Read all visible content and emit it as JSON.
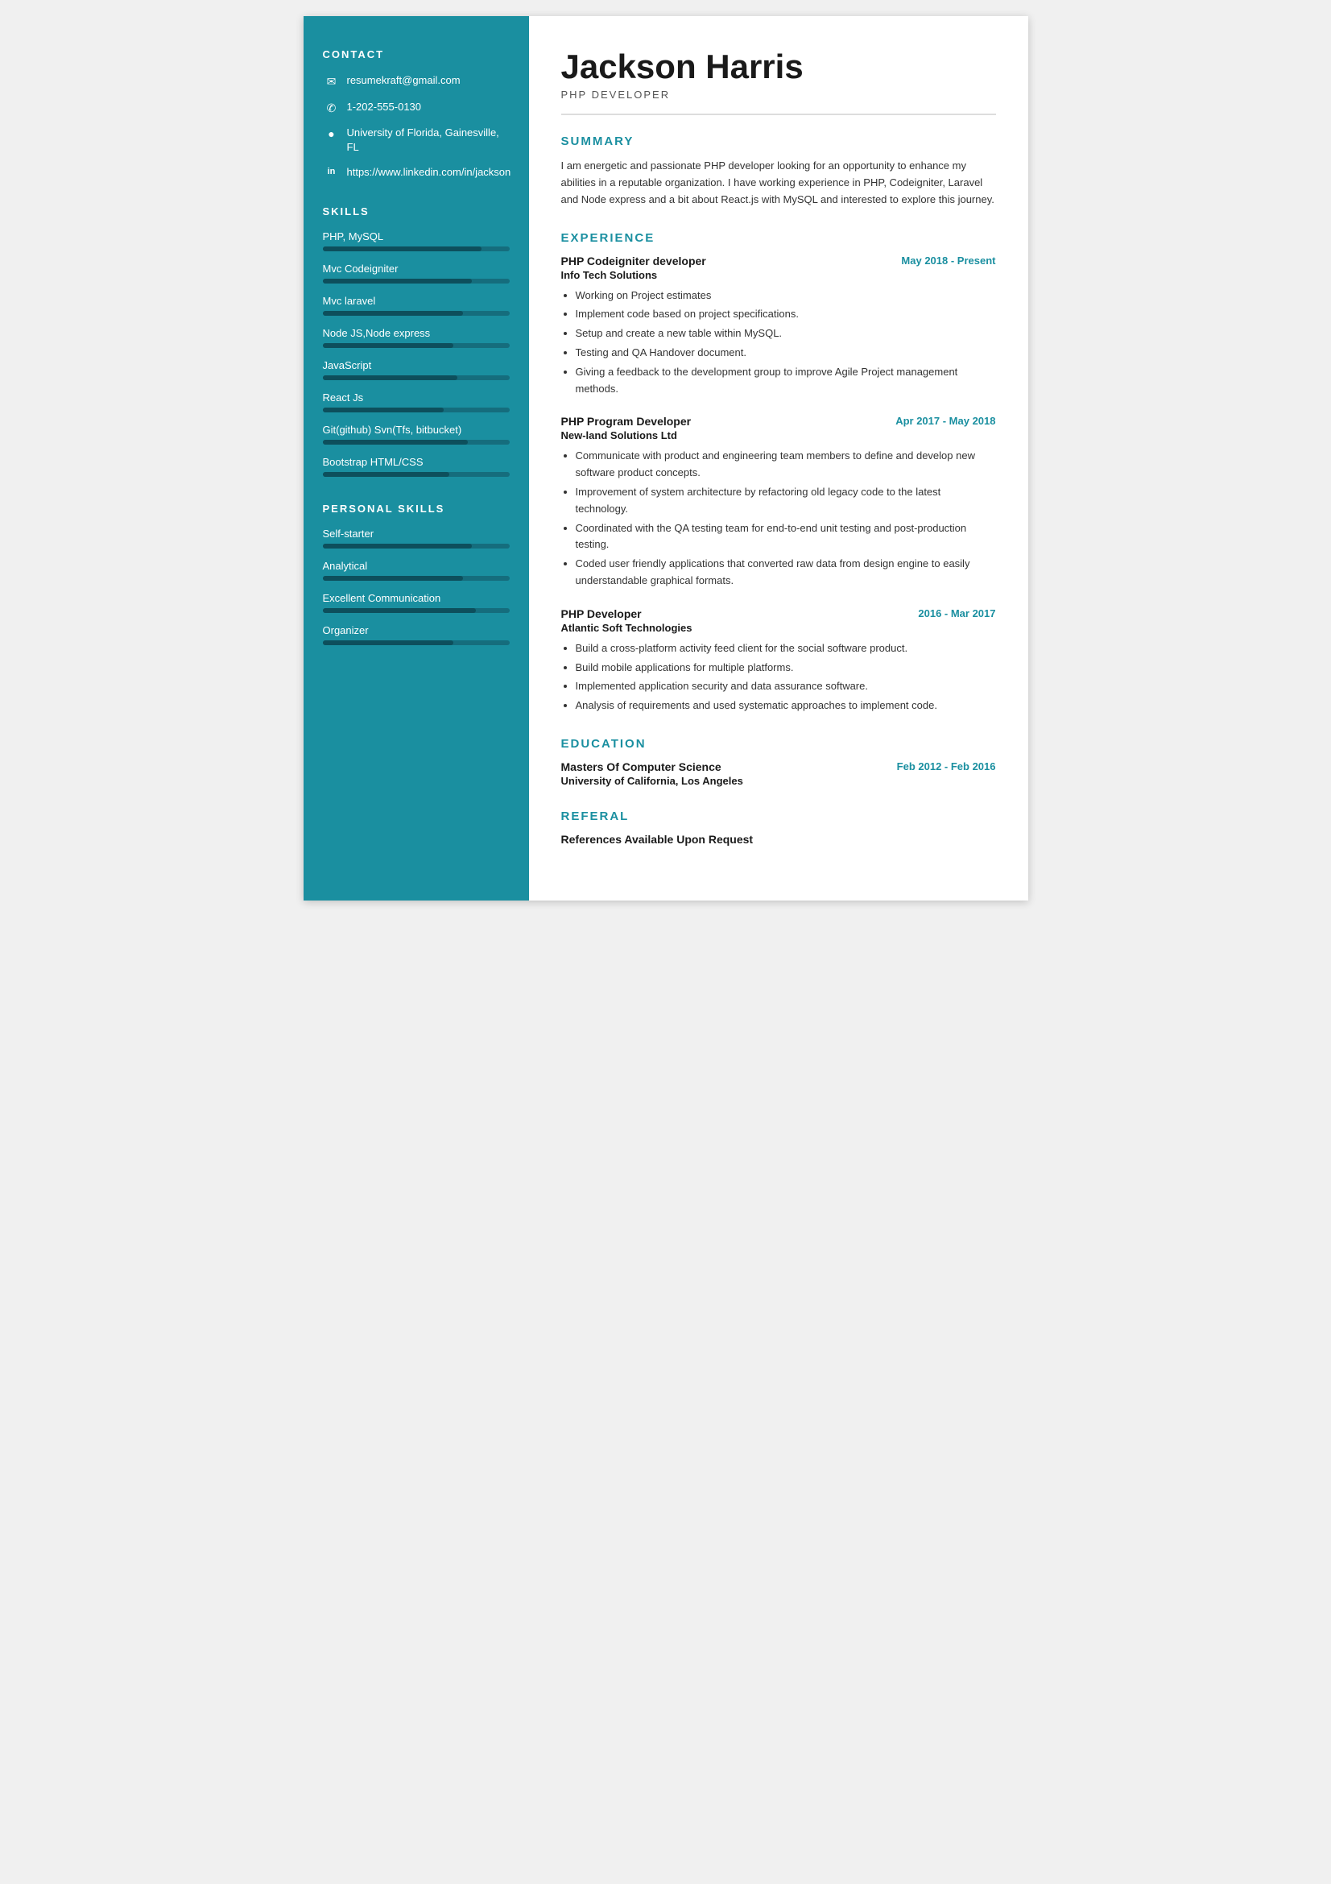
{
  "name": "Jackson Harris",
  "job_title": "PHP DEVELOPER",
  "contact": {
    "section_title": "CONTACT",
    "email": "resumekraft@gmail.com",
    "phone": "1-202-555-0130",
    "location": "University of Florida, Gainesville, FL",
    "linkedin": "https://www.linkedin.com/in/jackson"
  },
  "skills": {
    "section_title": "SKILLS",
    "items": [
      {
        "name": "PHP, MySQL",
        "bar_class": "bar-php"
      },
      {
        "name": "Mvc Codeigniter",
        "bar_class": "bar-mvc-ci"
      },
      {
        "name": "Mvc laravel",
        "bar_class": "bar-mvc-laravel"
      },
      {
        "name": "Node JS,Node express",
        "bar_class": "bar-nodejs"
      },
      {
        "name": "JavaScript",
        "bar_class": "bar-js"
      },
      {
        "name": "React Js",
        "bar_class": "bar-react"
      },
      {
        "name": "Git(github) Svn(Tfs, bitbucket)",
        "bar_class": "bar-git"
      },
      {
        "name": "Bootstrap HTML/CSS",
        "bar_class": "bar-bootstrap"
      }
    ]
  },
  "personal_skills": {
    "section_title": "PERSONAL SKILLS",
    "items": [
      {
        "name": "Self-starter",
        "bar_class": "bar-self"
      },
      {
        "name": "Analytical",
        "bar_class": "bar-analytical"
      },
      {
        "name": "Excellent Communication",
        "bar_class": "bar-communication"
      },
      {
        "name": "Organizer",
        "bar_class": "bar-organizer"
      }
    ]
  },
  "summary": {
    "section_title": "SUMMARY",
    "text": "I am energetic and passionate PHP developer looking for an opportunity to enhance my abilities in a reputable organization. I have working experience in PHP, Codeigniter, Laravel and Node express and a bit about React.js with MySQL and interested to explore this journey."
  },
  "experience": {
    "section_title": "EXPERIENCE",
    "entries": [
      {
        "job_title": "PHP Codeigniter developer",
        "company": "Info Tech Solutions",
        "date": "May 2018 - Present",
        "bullets": [
          "Working on Project estimates",
          "Implement code based on project specifications.",
          "Setup and create a new table within MySQL.",
          "Testing and QA Handover document.",
          "Giving a feedback to the development group to improve Agile Project management methods."
        ]
      },
      {
        "job_title": "PHP Program Developer",
        "company": "New-land Solutions Ltd",
        "date": "Apr 2017 - May 2018",
        "bullets": [
          "Communicate with product and engineering team members to define and develop new software product concepts.",
          "Improvement of system architecture by refactoring old legacy code to the latest technology.",
          "Coordinated with the QA testing team for end-to-end unit testing and post-production testing.",
          "Coded user friendly applications that converted raw data from design engine to easily understandable graphical formats."
        ]
      },
      {
        "job_title": "PHP Developer",
        "company": "Atlantic Soft Technologies",
        "date": "2016 - Mar 2017",
        "bullets": [
          "Build a cross-platform activity feed client for the social software product.",
          "Build mobile applications for multiple platforms.",
          "Implemented application security and data assurance software.",
          "Analysis of requirements and used systematic approaches to implement code."
        ]
      }
    ]
  },
  "education": {
    "section_title": "EDUCATION",
    "entries": [
      {
        "degree": "Masters Of Computer Science",
        "school": "University of California, Los Angeles",
        "date": "Feb 2012 - Feb 2016"
      }
    ]
  },
  "referal": {
    "section_title": "REFERAL",
    "text": "References Available Upon Request"
  }
}
